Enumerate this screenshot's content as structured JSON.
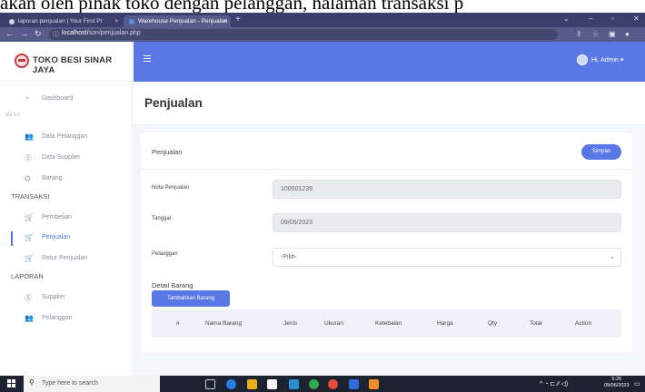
{
  "caption": "akan oleh pihak toko dengan pelanggan, halaman transaksi p",
  "browser": {
    "tabs": [
      {
        "title": "laporan penjualan | Your First Pr",
        "close": "×"
      },
      {
        "title": "Warehouse Penjualan - Penjualan",
        "close": "×"
      }
    ],
    "new_tab": "+",
    "url_host": "localhost/",
    "url_path": "son/penjualan.php",
    "info_icon": "ⓘ"
  },
  "brand": {
    "name": "TOKO BESI SINAR JAYA"
  },
  "sidebar": {
    "dashboard": {
      "label": "Dashboard",
      "icon": "dashboard-icon"
    },
    "menu_heading": "MENU",
    "menu": [
      {
        "label": "Data Pelanggan",
        "icon": "users-icon"
      },
      {
        "label": "Data Supplier",
        "icon": "supplier-icon"
      },
      {
        "label": "Barang",
        "icon": "box-icon"
      }
    ],
    "transaksi_heading": "TRANSAKSI",
    "transaksi": [
      {
        "label": "Pembelian",
        "icon": "cart-icon"
      },
      {
        "label": "Penjualan",
        "icon": "cart-icon",
        "active": true
      },
      {
        "label": "Retur Penjualan",
        "icon": "cart-icon"
      }
    ],
    "laporan_heading": "LAPORAN",
    "laporan": [
      {
        "label": "Supplier",
        "icon": "supplier-icon"
      },
      {
        "label": "Pelanggan",
        "icon": "users-icon"
      }
    ]
  },
  "topbar": {
    "user": "Hi, Admin ▾"
  },
  "page": {
    "title": "Penjualan"
  },
  "card": {
    "title": "Penjualan",
    "save_button": "Simpan",
    "fields": {
      "nota_label": "Nota Penjualan",
      "nota_value": "100001239",
      "tanggal_label": "Tanggal",
      "tanggal_value": "09/06/2023",
      "pelanggan_label": "Pelanggan",
      "pelanggan_value": "-Pilih-"
    },
    "detail_label": "Detail Barang",
    "add_button": "Tambahkan Barang",
    "table_headers": [
      "#",
      "Nama Barang",
      "Jenis",
      "Ukuran",
      "Ketebalan",
      "Harga",
      "Qty",
      "Total",
      "Action"
    ]
  },
  "taskbar": {
    "search_placeholder": "Type here to search",
    "tray": "^  ◔  ⊏  ∕∕  ◁)",
    "time": "5:26",
    "date": "09/06/2023"
  },
  "colors": {
    "accent": "#5a77e6",
    "browser": "#3a3f6b",
    "active_menu": "#4a7be0"
  }
}
